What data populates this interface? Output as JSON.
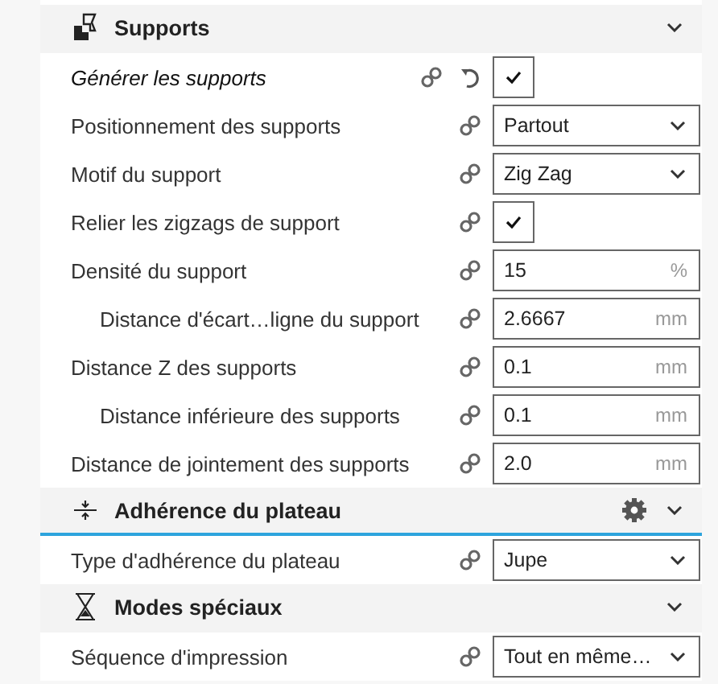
{
  "sections": [
    {
      "title": "Supports",
      "kind": "supports",
      "focused": false,
      "settings": [
        {
          "label": "Générer les supports",
          "kind": "checkbox",
          "checked": true,
          "modified": true
        },
        {
          "label": "Positionnement des supports",
          "kind": "dropdown",
          "value": "Partout",
          "modified": false
        },
        {
          "label": "Motif du support",
          "kind": "dropdown",
          "value": "Zig Zag",
          "modified": false
        },
        {
          "label": "Relier les zigzags de support",
          "kind": "checkbox",
          "checked": true,
          "modified": false
        },
        {
          "label": "Densité du support",
          "kind": "number",
          "value": "15",
          "unit": "%",
          "modified": false,
          "children": [
            {
              "label": "Distance d'écart…ligne du support",
              "kind": "number",
              "value": "2.6667",
              "unit": "mm",
              "modified": false
            }
          ]
        },
        {
          "label": "Distance Z des supports",
          "kind": "number",
          "value": "0.1",
          "unit": "mm",
          "modified": false,
          "children": [
            {
              "label": "Distance inférieure des supports",
              "kind": "number",
              "value": "0.1",
              "unit": "mm",
              "modified": false
            }
          ]
        },
        {
          "label": "Distance de jointement des supports",
          "kind": "number",
          "value": "2.0",
          "unit": "mm",
          "modified": false
        }
      ]
    },
    {
      "title": "Adhérence du plateau",
      "kind": "adhesion",
      "focused": true,
      "settings": [
        {
          "label": "Type d'adhérence du plateau",
          "kind": "dropdown",
          "value": "Jupe",
          "modified": false
        }
      ]
    },
    {
      "title": "Modes spéciaux",
      "kind": "special",
      "focused": false,
      "settings": [
        {
          "label": "Séquence d'impression",
          "kind": "dropdown",
          "value": "Tout en même…",
          "modified": false
        }
      ]
    }
  ]
}
